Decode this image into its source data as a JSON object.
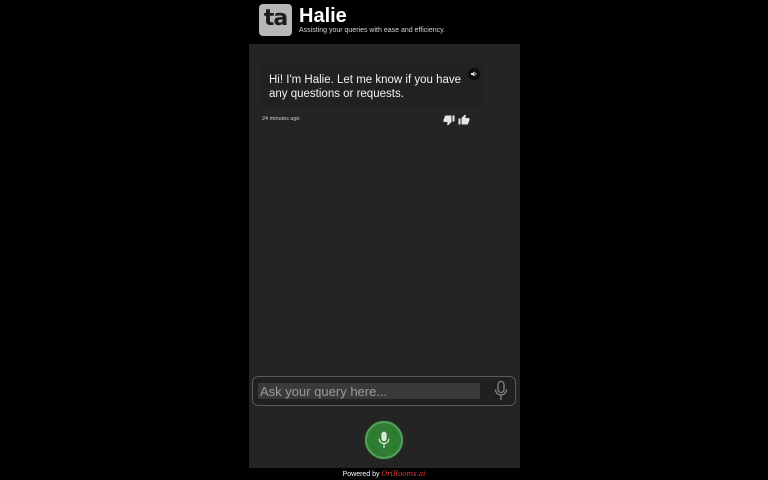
{
  "header": {
    "logo_text": "ta",
    "title": "Halie",
    "subtitle": "Assisting your queries with ease and efficiency."
  },
  "conversation": {
    "messages": [
      {
        "text": "Hi! I'm Halie. Let me know if you have any questions or requests.",
        "timestamp": "24 minutes ago"
      }
    ]
  },
  "input": {
    "placeholder": "Ask your query here...",
    "value": ""
  },
  "footer": {
    "prefix": "Powered by",
    "brand": "OriRooms.ai"
  },
  "colors": {
    "background": "#000000",
    "panel": "#242424",
    "mic_button": "#2e7d32",
    "brand": "#e53935"
  },
  "icons": {
    "speaker": "speaker-icon",
    "thumbs_down": "thumbs-down-icon",
    "thumbs_up": "thumbs-up-icon",
    "microphone": "microphone-icon"
  }
}
